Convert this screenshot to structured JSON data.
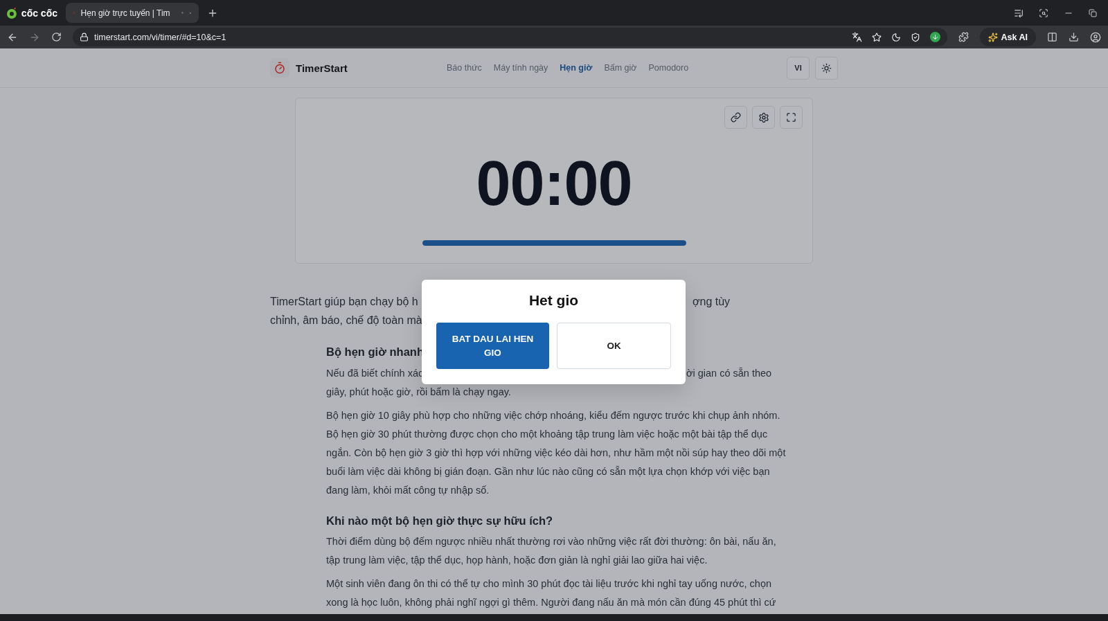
{
  "browser": {
    "brand": "cốc cốc",
    "tab": {
      "title": "Hẹn giờ trực tuyến | Tim",
      "selected": true
    },
    "url": "timerstart.com/vi/timer/#d=10&c=1",
    "ask_ai": "Ask AI"
  },
  "header": {
    "logo": "TimerStart",
    "nav": [
      {
        "label": "Báo thức",
        "selected": false
      },
      {
        "label": "Máy tính ngày",
        "selected": false
      },
      {
        "label": "Hẹn giờ",
        "selected": true
      },
      {
        "label": "Bấm giờ",
        "selected": false
      },
      {
        "label": "Pomodoro",
        "selected": false
      }
    ],
    "language": "VI"
  },
  "timer": {
    "display": "00:00",
    "level": 1
  },
  "intro": [
    [
      "TimerStart giúp bạn chạy bộ h",
      "ợng tùy"
    ],
    [
      "chỉnh, âm báo, chế độ toàn mà"
    ]
  ],
  "article": [
    {
      "kind": "heading",
      "lines": [
        [
          "Bộ hẹn giờ nhanh"
        ]
      ]
    },
    {
      "kind": "paragraph",
      "lines": [
        [
          "Nếu đã biết chính xác",
          "ời gian có sẵn theo"
        ],
        [
          "giây, phút hoặc giờ, rồi bấm là chạy ngay."
        ]
      ]
    },
    {
      "kind": "paragraph",
      "text": "Bộ hẹn giờ 10 giây phù hợp cho những việc chớp nhoáng, kiểu đếm ngược trước khi chụp ảnh nhóm. Bộ hẹn giờ 30 phút thường được chọn cho một khoảng tập trung làm việc hoặc một bài tập thể dục ngắn. Còn bộ hẹn giờ 3 giờ thì hợp với những việc kéo dài hơn, như hầm một nồi súp hay theo dõi một buổi làm việc dài không bị gián đoạn. Gần như lúc nào cũng có sẵn một lựa chọn khớp với việc bạn đang làm, khỏi mất công tự nhập số."
    },
    {
      "kind": "heading",
      "text": "Khi nào một bộ hẹn giờ thực sự hữu ích?"
    },
    {
      "kind": "paragraph",
      "text": "Thời điểm dùng bộ đếm ngược nhiều nhất thường rơi vào những việc rất đời thường: ôn bài, nấu ăn, tập trung làm việc, tập thể dục, họp hành, hoặc đơn giản là nghỉ giải lao giữa hai việc."
    },
    {
      "kind": "paragraph",
      "text": "Một sinh viên đang ôn thi có thể tự cho mình 30 phút đọc tài liệu trước khi nghỉ tay uống nước, chọn xong là học luôn, không phải nghĩ ngợi gì thêm. Người đang nấu ăn mà món cần đúng 45 phút thì cứ"
    }
  ],
  "dialog": {
    "title": "Het gio",
    "buttons": [
      {
        "label": "BAT DAU LAI HEN GIO",
        "kind": "primary"
      },
      {
        "label": "OK",
        "kind": "secondary"
      }
    ]
  }
}
